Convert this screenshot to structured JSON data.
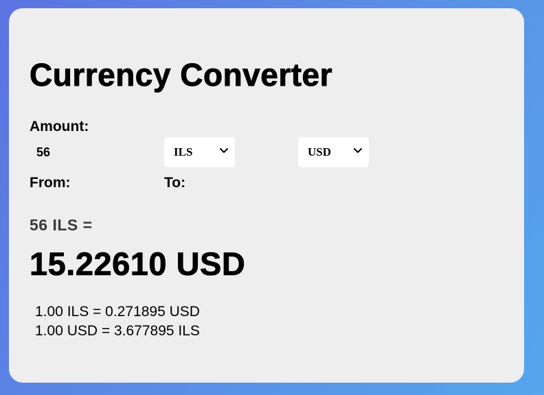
{
  "app": {
    "title": "Currency Converter"
  },
  "amount": {
    "label": "Amount:",
    "value": "56"
  },
  "from": {
    "label": "From:",
    "selected": "ILS"
  },
  "to": {
    "label": "To:",
    "selected": "USD"
  },
  "result": {
    "from_text": "56 ILS =",
    "to_text": "15.22610 USD",
    "rate_forward": "1.00 ILS = 0.271895 USD",
    "rate_reverse": "1.00 USD = 3.677895 ILS"
  },
  "colors": {
    "card_background": "#eeeeee",
    "gradient_start": "#5c73e0",
    "gradient_end": "#56a6ec",
    "subtext": "#3a3a3a"
  }
}
